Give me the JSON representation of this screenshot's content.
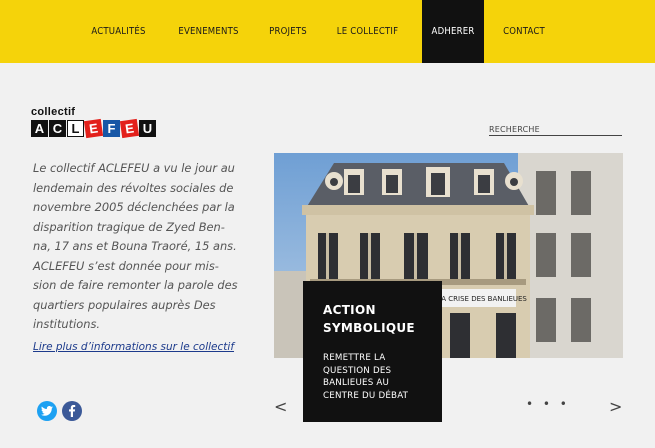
{
  "nav": {
    "items": [
      {
        "label": "ACTUALITÉS"
      },
      {
        "label": "EVENEMENTS"
      },
      {
        "label": "PROJETS"
      },
      {
        "label": "LE COLLECTIF"
      },
      {
        "label": "ADHERER"
      },
      {
        "label": "CONTACT"
      }
    ],
    "active_label": "ADHERER"
  },
  "logo": {
    "small": "collectif",
    "letters": [
      "A",
      "C",
      "L",
      "E",
      "F",
      "E",
      "U"
    ]
  },
  "search": {
    "label": "RECHERCHE"
  },
  "intro": {
    "lines": [
      "Le collectif ACLEFEU a vu le jour au",
      "lendemain des révoltes sociales de",
      "novembre 2005 déclenchées par la",
      "disparition tragique de Zyed Ben-",
      "na, 17 ans et Bouna Traoré, 15 ans.",
      "ACLEFEU s’est donnée pour mis-",
      "sion de faire remonter la parole des",
      "quartiers populaires auprès Des",
      "institutions."
    ],
    "link": "Lire plus d’informations sur le collectif"
  },
  "slide": {
    "title_line1": "ACTION",
    "title_line2": "SYMBOLIQUE",
    "text_lines": [
      "REMETTRE LA",
      "QUESTION DES",
      "BANLIEUES AU",
      "CENTRE DU DÉBAT"
    ],
    "banner_text": "MINISTÈRE DE LA CRISE DES BANLIEUES"
  },
  "slider": {
    "prev": "<",
    "next": ">",
    "dots": "• • •"
  },
  "social": {
    "twitter_icon": "twitter-icon",
    "facebook_icon": "facebook-icon"
  },
  "colors": {
    "brand_yellow": "#f5d30a",
    "active_nav": "#111111",
    "link_blue": "#1d3b8c"
  }
}
